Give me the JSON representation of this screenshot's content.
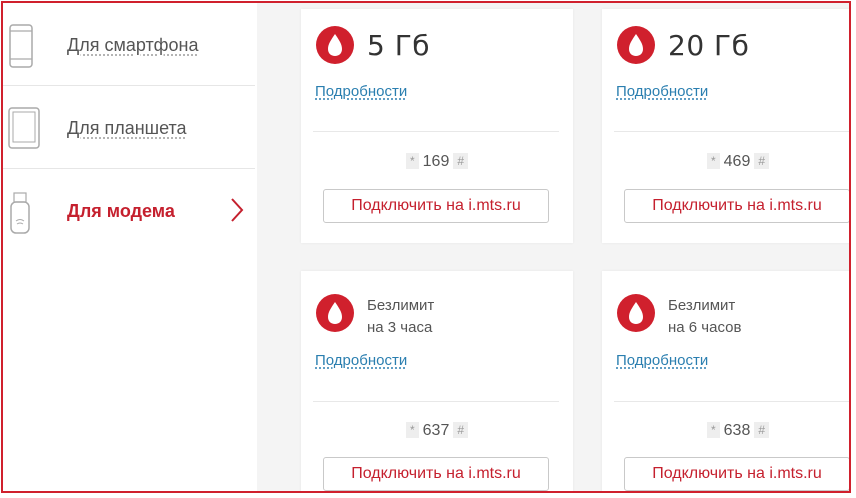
{
  "sidebar": {
    "items": [
      {
        "label": "Для смартфона",
        "icon": "smartphone-icon",
        "active": false
      },
      {
        "label": "Для планшета",
        "icon": "tablet-icon",
        "active": false
      },
      {
        "label": "Для модема",
        "icon": "usb-modem-icon",
        "active": true
      }
    ]
  },
  "cards": [
    {
      "volume": "5 Гб",
      "details_label": "Подробности",
      "code_prefix": "*",
      "code": "169",
      "code_suffix": "#",
      "button_label": "Подключить на i.mts.ru"
    },
    {
      "volume": "20 Гб",
      "details_label": "Подробности",
      "code_prefix": "*",
      "code": "469",
      "code_suffix": "#",
      "button_label": "Подключить на i.mts.ru"
    },
    {
      "title_line1": "Безлимит",
      "title_line2": "на 3 часа",
      "details_label": "Подробности",
      "code_prefix": "*",
      "code": "637",
      "code_suffix": "#",
      "button_label": "Подключить на i.mts.ru"
    },
    {
      "title_line1": "Безлимит",
      "title_line2": "на 6 часов",
      "details_label": "Подробности",
      "code_prefix": "*",
      "code": "638",
      "code_suffix": "#",
      "button_label": "Подключить на i.mts.ru"
    }
  ],
  "colors": {
    "brand_red": "#d0202d",
    "link_blue": "#2b7fb0",
    "frame_border": "#d0202d"
  }
}
